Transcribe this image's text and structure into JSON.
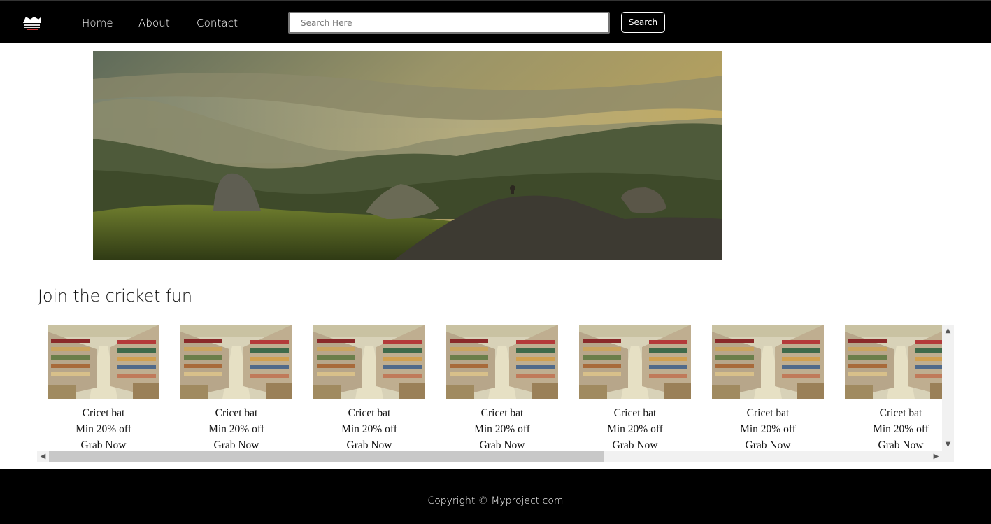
{
  "navbar": {
    "logo_icon": "brand-logo-icon",
    "links": [
      {
        "label": "Home"
      },
      {
        "label": "About"
      },
      {
        "label": "Contact"
      }
    ],
    "search": {
      "placeholder": "Search Here",
      "value": ""
    },
    "search_button_label": "Search"
  },
  "hero": {
    "image": "mountain-landscape-banner"
  },
  "section": {
    "title": "Join the cricket fun"
  },
  "products": [
    {
      "name": "Cricet bat",
      "offer": "Min 20% off",
      "cta": "Grab Now"
    },
    {
      "name": "Cricet bat",
      "offer": "Min 20% off",
      "cta": "Grab Now"
    },
    {
      "name": "Cricet bat",
      "offer": "Min 20% off",
      "cta": "Grab Now"
    },
    {
      "name": "Cricet bat",
      "offer": "Min 20% off",
      "cta": "Grab Now"
    },
    {
      "name": "Cricet bat",
      "offer": "Min 20% off",
      "cta": "Grab Now"
    },
    {
      "name": "Cricet bat",
      "offer": "Min 20% off",
      "cta": "Grab Now"
    },
    {
      "name": "Cricet bat",
      "offer": "Min 20% off",
      "cta": "Grab Now"
    }
  ],
  "footer": {
    "text": "Copyright © Myproject.com"
  },
  "colors": {
    "navbar_bg": "#000000",
    "footer_bg": "#000000",
    "page_bg": "#ffffff"
  }
}
